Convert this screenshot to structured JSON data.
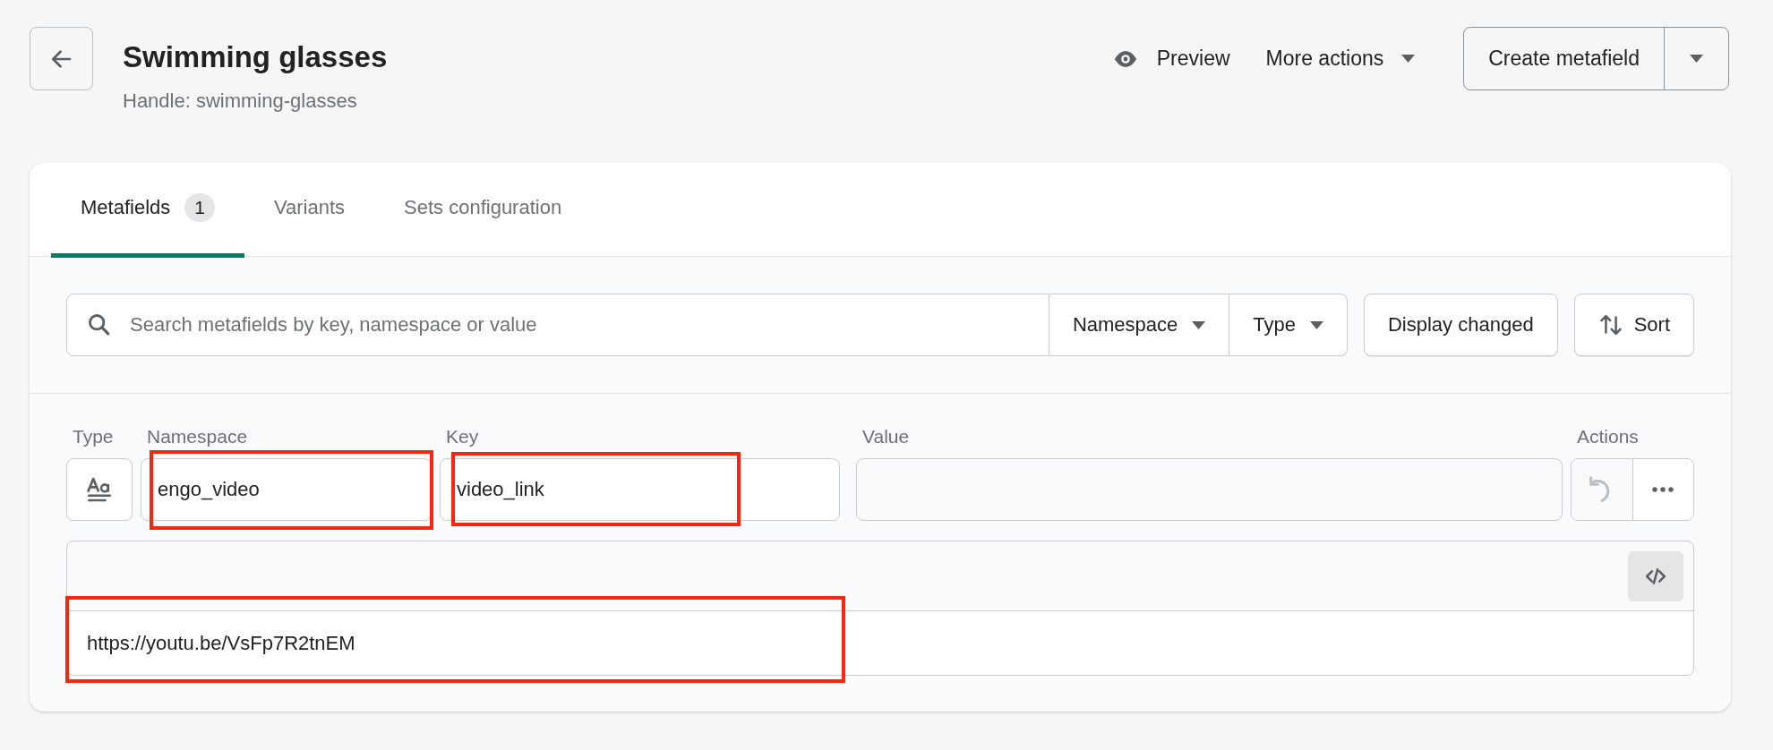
{
  "header": {
    "title": "Swimming glasses",
    "handle": "Handle: swimming-glasses",
    "actions": [
      {
        "label": "Preview",
        "kind": "preview"
      },
      {
        "label": "More actions",
        "kind": "dropdown"
      }
    ],
    "primary_button": "Create metafield"
  },
  "tabs": [
    {
      "label": "Metafields",
      "badge": "1",
      "selected": true
    },
    {
      "label": "Variants",
      "selected": false
    },
    {
      "label": "Sets configuration",
      "selected": false
    }
  ],
  "filters": {
    "search": {
      "placeholder": "Search metafields by key, namespace or value"
    },
    "dropdowns": [
      "Namespace",
      "Type"
    ],
    "buttons": [
      {
        "label": "Display changed",
        "kind": "plain"
      },
      {
        "label": "Sort",
        "kind": "sort"
      }
    ]
  },
  "table": {
    "columns": [
      "Type",
      "Namespace",
      "Key",
      "Value",
      "Actions"
    ],
    "rows": [
      {
        "namespace": {
          "value": "engo_video",
          "highlighted": true
        },
        "key": {
          "value": "video_link",
          "highlighted": true
        },
        "undo": {
          "disabled": true
        },
        "editor": {
          "value": "https://youtu.be/VsFp7R2tnEM",
          "highlighted": true
        }
      }
    ]
  }
}
